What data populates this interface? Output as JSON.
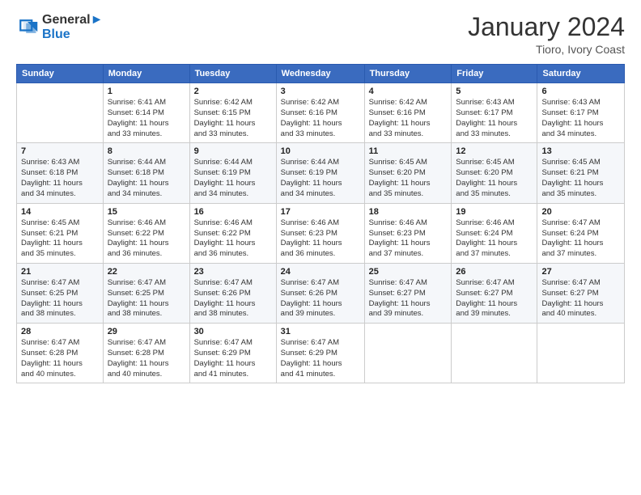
{
  "header": {
    "logo_line1": "General",
    "logo_line2": "Blue",
    "month": "January 2024",
    "location": "Tioro, Ivory Coast"
  },
  "weekdays": [
    "Sunday",
    "Monday",
    "Tuesday",
    "Wednesday",
    "Thursday",
    "Friday",
    "Saturday"
  ],
  "weeks": [
    [
      {
        "day": "",
        "info": ""
      },
      {
        "day": "1",
        "info": "Sunrise: 6:41 AM\nSunset: 6:14 PM\nDaylight: 11 hours\nand 33 minutes."
      },
      {
        "day": "2",
        "info": "Sunrise: 6:42 AM\nSunset: 6:15 PM\nDaylight: 11 hours\nand 33 minutes."
      },
      {
        "day": "3",
        "info": "Sunrise: 6:42 AM\nSunset: 6:16 PM\nDaylight: 11 hours\nand 33 minutes."
      },
      {
        "day": "4",
        "info": "Sunrise: 6:42 AM\nSunset: 6:16 PM\nDaylight: 11 hours\nand 33 minutes."
      },
      {
        "day": "5",
        "info": "Sunrise: 6:43 AM\nSunset: 6:17 PM\nDaylight: 11 hours\nand 33 minutes."
      },
      {
        "day": "6",
        "info": "Sunrise: 6:43 AM\nSunset: 6:17 PM\nDaylight: 11 hours\nand 34 minutes."
      }
    ],
    [
      {
        "day": "7",
        "info": "Sunrise: 6:43 AM\nSunset: 6:18 PM\nDaylight: 11 hours\nand 34 minutes."
      },
      {
        "day": "8",
        "info": "Sunrise: 6:44 AM\nSunset: 6:18 PM\nDaylight: 11 hours\nand 34 minutes."
      },
      {
        "day": "9",
        "info": "Sunrise: 6:44 AM\nSunset: 6:19 PM\nDaylight: 11 hours\nand 34 minutes."
      },
      {
        "day": "10",
        "info": "Sunrise: 6:44 AM\nSunset: 6:19 PM\nDaylight: 11 hours\nand 34 minutes."
      },
      {
        "day": "11",
        "info": "Sunrise: 6:45 AM\nSunset: 6:20 PM\nDaylight: 11 hours\nand 35 minutes."
      },
      {
        "day": "12",
        "info": "Sunrise: 6:45 AM\nSunset: 6:20 PM\nDaylight: 11 hours\nand 35 minutes."
      },
      {
        "day": "13",
        "info": "Sunrise: 6:45 AM\nSunset: 6:21 PM\nDaylight: 11 hours\nand 35 minutes."
      }
    ],
    [
      {
        "day": "14",
        "info": "Sunrise: 6:45 AM\nSunset: 6:21 PM\nDaylight: 11 hours\nand 35 minutes."
      },
      {
        "day": "15",
        "info": "Sunrise: 6:46 AM\nSunset: 6:22 PM\nDaylight: 11 hours\nand 36 minutes."
      },
      {
        "day": "16",
        "info": "Sunrise: 6:46 AM\nSunset: 6:22 PM\nDaylight: 11 hours\nand 36 minutes."
      },
      {
        "day": "17",
        "info": "Sunrise: 6:46 AM\nSunset: 6:23 PM\nDaylight: 11 hours\nand 36 minutes."
      },
      {
        "day": "18",
        "info": "Sunrise: 6:46 AM\nSunset: 6:23 PM\nDaylight: 11 hours\nand 37 minutes."
      },
      {
        "day": "19",
        "info": "Sunrise: 6:46 AM\nSunset: 6:24 PM\nDaylight: 11 hours\nand 37 minutes."
      },
      {
        "day": "20",
        "info": "Sunrise: 6:47 AM\nSunset: 6:24 PM\nDaylight: 11 hours\nand 37 minutes."
      }
    ],
    [
      {
        "day": "21",
        "info": "Sunrise: 6:47 AM\nSunset: 6:25 PM\nDaylight: 11 hours\nand 38 minutes."
      },
      {
        "day": "22",
        "info": "Sunrise: 6:47 AM\nSunset: 6:25 PM\nDaylight: 11 hours\nand 38 minutes."
      },
      {
        "day": "23",
        "info": "Sunrise: 6:47 AM\nSunset: 6:26 PM\nDaylight: 11 hours\nand 38 minutes."
      },
      {
        "day": "24",
        "info": "Sunrise: 6:47 AM\nSunset: 6:26 PM\nDaylight: 11 hours\nand 39 minutes."
      },
      {
        "day": "25",
        "info": "Sunrise: 6:47 AM\nSunset: 6:27 PM\nDaylight: 11 hours\nand 39 minutes."
      },
      {
        "day": "26",
        "info": "Sunrise: 6:47 AM\nSunset: 6:27 PM\nDaylight: 11 hours\nand 39 minutes."
      },
      {
        "day": "27",
        "info": "Sunrise: 6:47 AM\nSunset: 6:27 PM\nDaylight: 11 hours\nand 40 minutes."
      }
    ],
    [
      {
        "day": "28",
        "info": "Sunrise: 6:47 AM\nSunset: 6:28 PM\nDaylight: 11 hours\nand 40 minutes."
      },
      {
        "day": "29",
        "info": "Sunrise: 6:47 AM\nSunset: 6:28 PM\nDaylight: 11 hours\nand 40 minutes."
      },
      {
        "day": "30",
        "info": "Sunrise: 6:47 AM\nSunset: 6:29 PM\nDaylight: 11 hours\nand 41 minutes."
      },
      {
        "day": "31",
        "info": "Sunrise: 6:47 AM\nSunset: 6:29 PM\nDaylight: 11 hours\nand 41 minutes."
      },
      {
        "day": "",
        "info": ""
      },
      {
        "day": "",
        "info": ""
      },
      {
        "day": "",
        "info": ""
      }
    ]
  ]
}
